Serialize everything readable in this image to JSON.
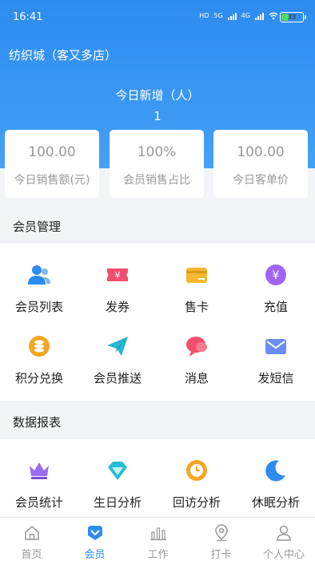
{
  "status_bar": {
    "time": "16:41",
    "hd": "HD",
    "net1": "5G",
    "net2": "4G",
    "battery": "33",
    "battery_level": 0.33
  },
  "header": {
    "store_name": "纺织城（客又多店）",
    "today_new_label": "今日新增（人）",
    "today_new_value": "1"
  },
  "stats": [
    {
      "value": "100.00",
      "label": "今日销售额(元)"
    },
    {
      "value": "100%",
      "label": "会员销售占比"
    },
    {
      "value": "100.00",
      "label": "今日客单价"
    }
  ],
  "member_management": {
    "title": "会员管理",
    "items": [
      {
        "label": "会员列表",
        "icon": "member-list-icon",
        "color": "#2e8cf0"
      },
      {
        "label": "发券",
        "icon": "coupon-icon",
        "color": "#f0506e"
      },
      {
        "label": "售卡",
        "icon": "card-icon",
        "color": "#f5b82e"
      },
      {
        "label": "充值",
        "icon": "recharge-icon",
        "color": "#a065f0"
      },
      {
        "label": "积分兑换",
        "icon": "points-icon",
        "color": "#f5a623"
      },
      {
        "label": "会员推送",
        "icon": "send-icon",
        "color": "#25b7d3"
      },
      {
        "label": "消息",
        "icon": "message-icon",
        "color": "#f0506e"
      },
      {
        "label": "发短信",
        "icon": "mail-icon",
        "color": "#6b8ef5"
      }
    ]
  },
  "data_reports": {
    "title": "数据报表",
    "items": [
      {
        "label": "会员统计",
        "icon": "crown-icon",
        "color": "#9b6cf0"
      },
      {
        "label": "生日分析",
        "icon": "diamond-icon",
        "color": "#25c0d3"
      },
      {
        "label": "回访分析",
        "icon": "clock-icon",
        "color": "#f5a623"
      },
      {
        "label": "休眠分析",
        "icon": "sleep-icon",
        "color": "#2e8cf0"
      }
    ]
  },
  "tabbar": {
    "tabs": [
      {
        "label": "首页",
        "icon": "home-icon"
      },
      {
        "label": "会员",
        "icon": "member-icon"
      },
      {
        "label": "工作",
        "icon": "work-icon"
      },
      {
        "label": "打卡",
        "icon": "location-icon"
      },
      {
        "label": "个人中心",
        "icon": "profile-icon"
      }
    ],
    "active_color": "#2e8cf0",
    "inactive_color": "#999999"
  }
}
